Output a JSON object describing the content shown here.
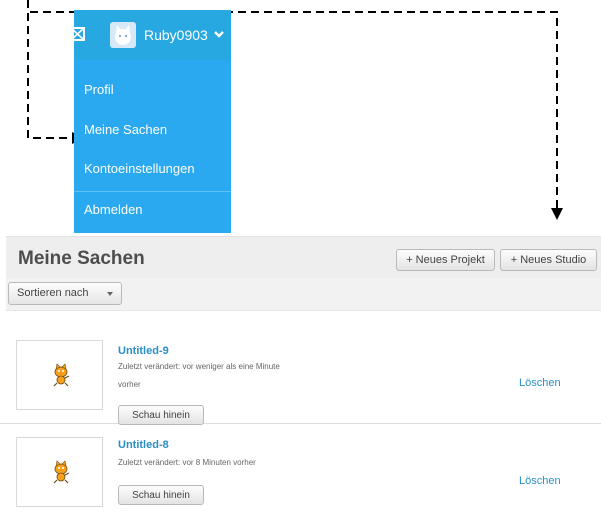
{
  "account": {
    "username": "Ruby0903",
    "icons": {
      "messages": "mail-icon",
      "avatar": "cat-avatar-icon",
      "dropdown": "chevron-down-icon"
    }
  },
  "menu": {
    "items": [
      "Profil",
      "Meine Sachen",
      "Kontoeinstellungen",
      "Abmelden"
    ]
  },
  "page": {
    "title": "Meine Sachen",
    "new_project": "+ Neues Projekt",
    "new_studio": "+ Neues Studio",
    "sort_label": "Sortieren nach"
  },
  "projects": [
    {
      "title": "Untitled-9",
      "meta_line1": "Zuletzt verändert: vor weniger als eine Minute",
      "meta_line2": "vorher",
      "view": "Schau hinein",
      "delete": "Löschen"
    },
    {
      "title": "Untitled-8",
      "meta_line1": "Zuletzt verändert: vor 8 Minuten vorher",
      "view": "Schau hinein",
      "delete": "Löschen"
    }
  ],
  "colors": {
    "menu_bg": "#2aa9f0",
    "topbar_bg": "#27a8e0",
    "link": "#2a8fc7",
    "header_bg": "#eeeeee"
  }
}
